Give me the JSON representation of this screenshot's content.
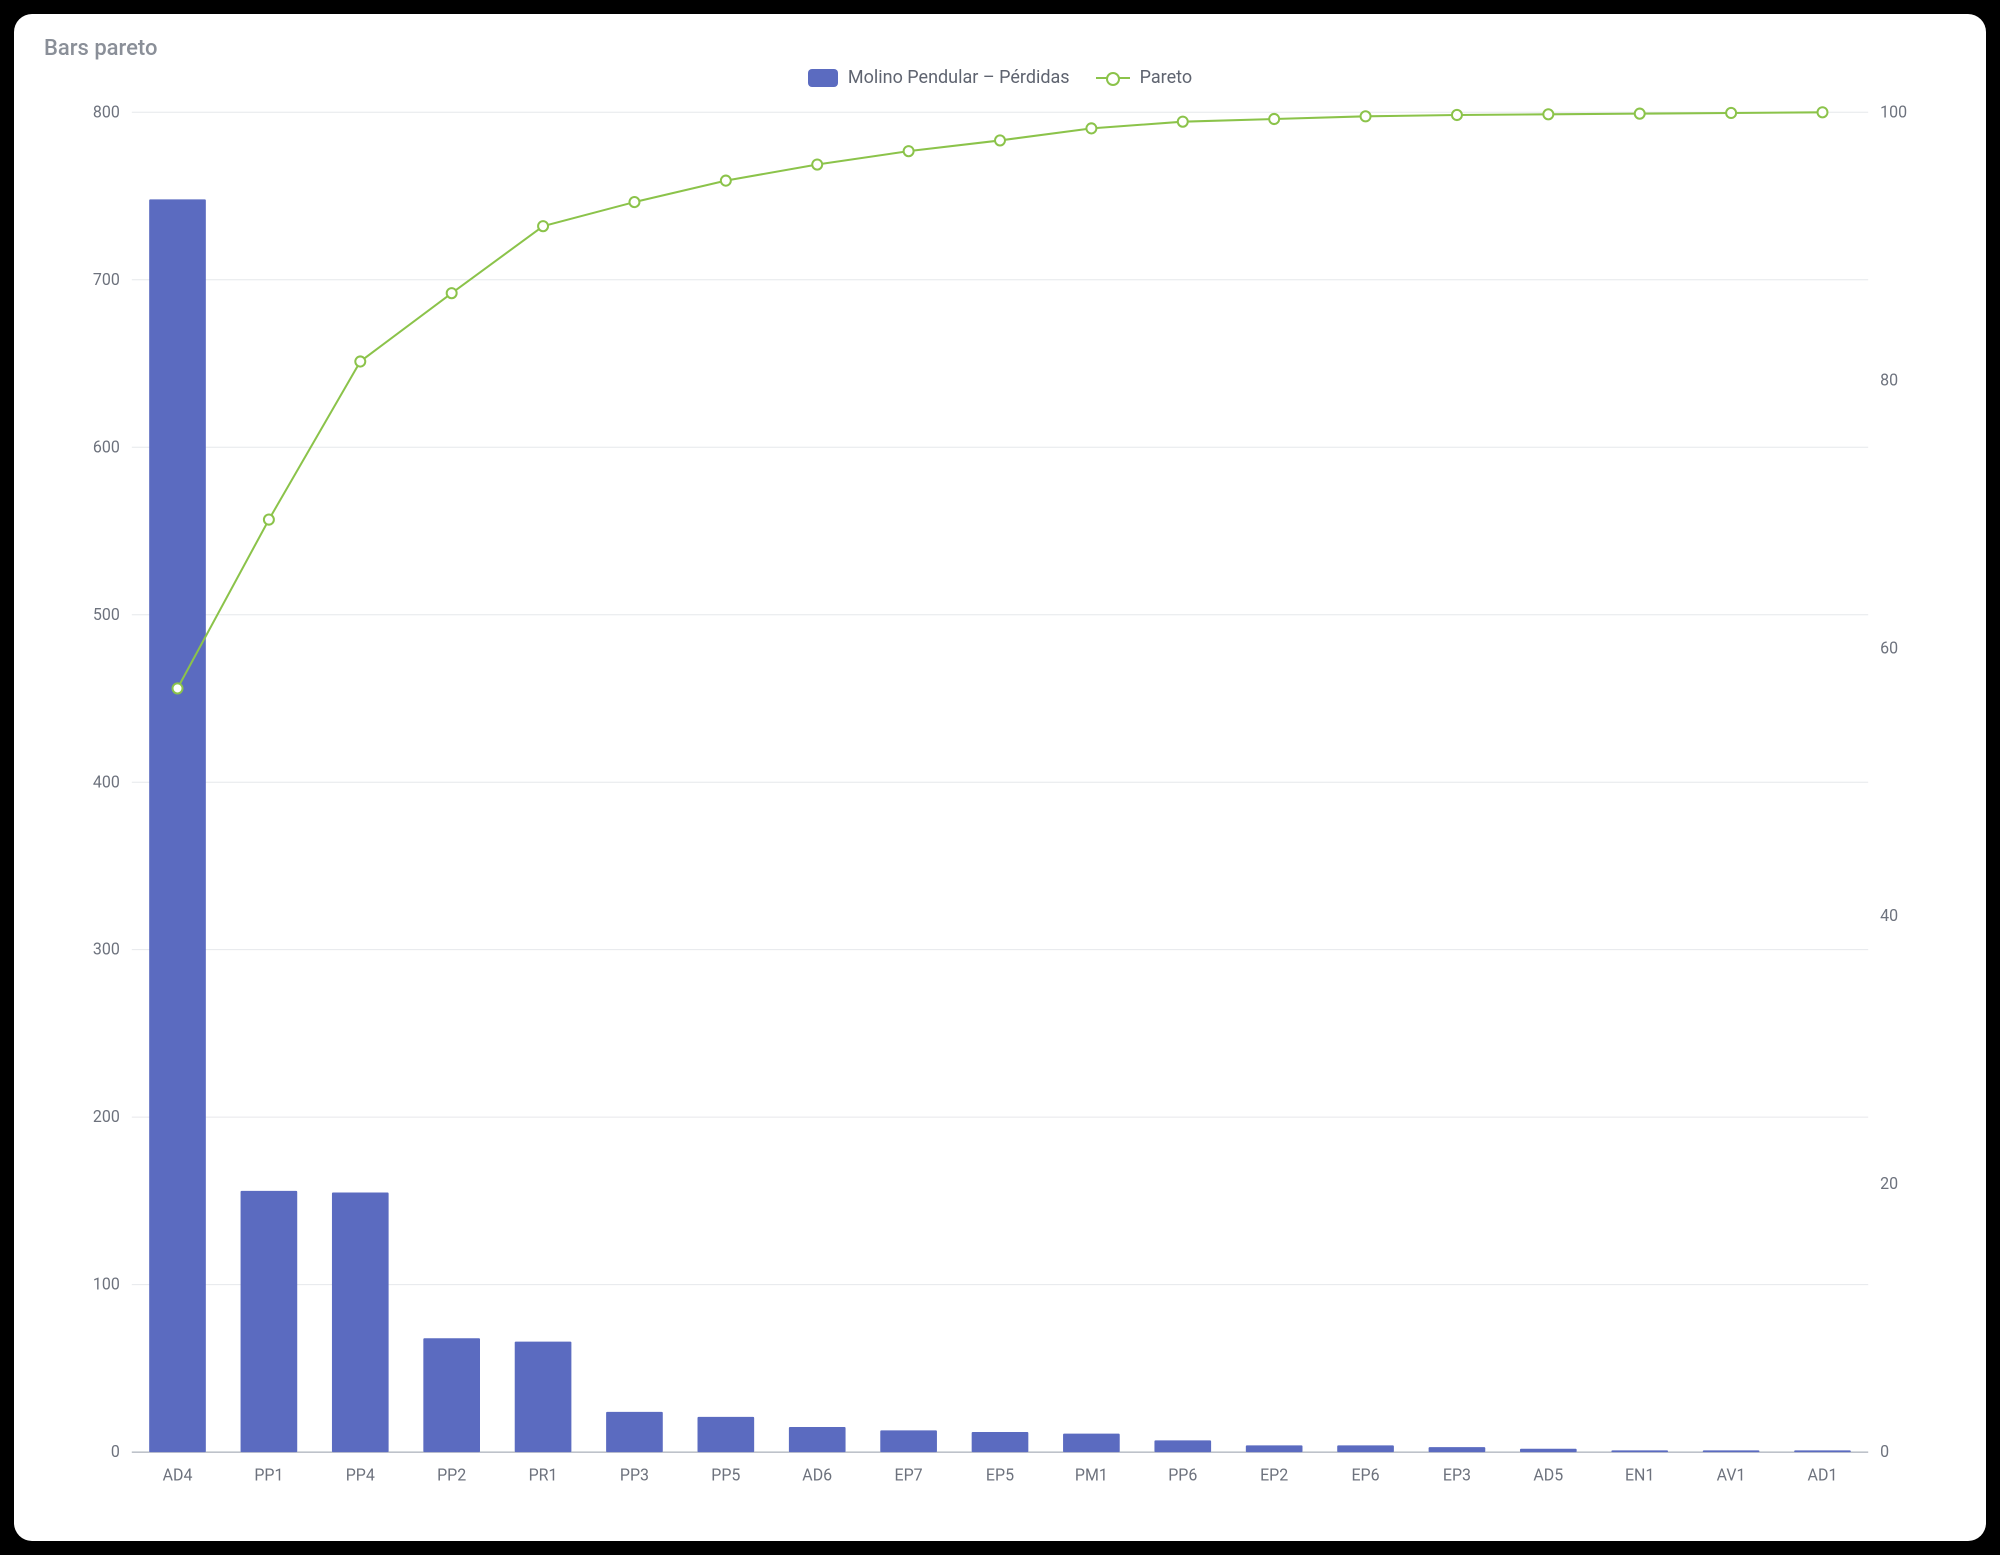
{
  "title": "Bars pareto",
  "legend": {
    "bars": "Molino Pendular – Pérdidas",
    "line": "Pareto"
  },
  "chart_data": {
    "type": "bar",
    "categories": [
      "AD4",
      "PP1",
      "PP4",
      "PP2",
      "PR1",
      "PP3",
      "PP5",
      "AD6",
      "EP7",
      "EP5",
      "PM1",
      "PP6",
      "EP2",
      "EP6",
      "EP3",
      "AD5",
      "EN1",
      "AV1",
      "AD1"
    ],
    "series": [
      {
        "name": "Molino Pendular – Pérdidas",
        "axis": "left",
        "type": "bar",
        "values": [
          748,
          156,
          155,
          68,
          66,
          24,
          21,
          15,
          13,
          12,
          11,
          7,
          4,
          4,
          3,
          2,
          1,
          1,
          1
        ]
      },
      {
        "name": "Pareto",
        "axis": "right",
        "type": "line",
        "values": [
          57.0,
          69.6,
          81.4,
          86.5,
          91.5,
          93.3,
          94.9,
          96.1,
          97.1,
          97.9,
          98.8,
          99.3,
          99.5,
          99.7,
          99.8,
          99.85,
          99.9,
          99.95,
          100.0
        ]
      }
    ],
    "ylabel_left": "",
    "ylabel_right": "",
    "ylim_left": [
      0,
      800
    ],
    "yticks_left": [
      0,
      100,
      200,
      300,
      400,
      500,
      600,
      700,
      800
    ],
    "ylim_right": [
      0,
      100
    ],
    "yticks_right": [
      0,
      20,
      40,
      60,
      80,
      100
    ]
  }
}
